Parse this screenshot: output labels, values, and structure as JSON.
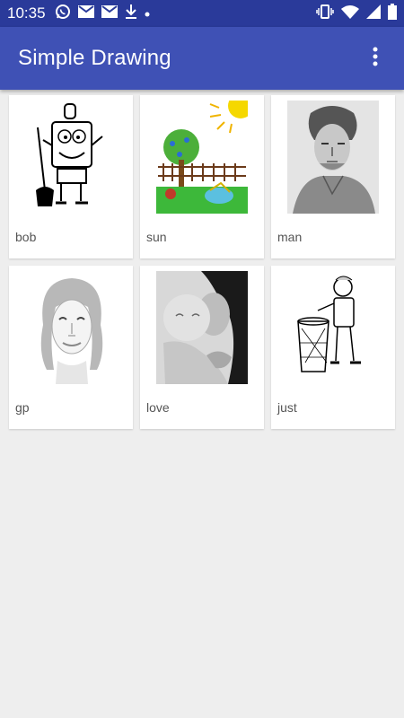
{
  "status_bar": {
    "time": "10:35",
    "left_icons": [
      "whatsapp-icon",
      "mail-icon",
      "mail-icon",
      "download-icon",
      "dot-icon"
    ],
    "right_icons": [
      "vibrate-icon",
      "wifi-icon",
      "signal-icon",
      "battery-icon"
    ]
  },
  "app_bar": {
    "title": "Simple Drawing",
    "menu_icon": "more-vert-icon"
  },
  "colors": {
    "status_bar": "#2a3a9a",
    "app_bar": "#3f51b5",
    "background": "#eeeeee"
  },
  "drawings": [
    {
      "label": "bob"
    },
    {
      "label": "sun"
    },
    {
      "label": "man"
    },
    {
      "label": "gp"
    },
    {
      "label": "love"
    },
    {
      "label": "just"
    }
  ]
}
